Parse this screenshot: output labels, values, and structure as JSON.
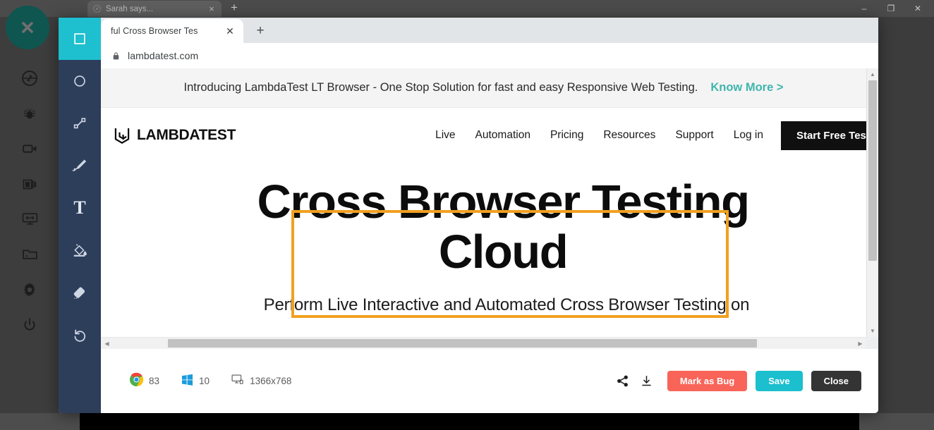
{
  "background_window": {
    "tab": {
      "title": "Sarah says...",
      "close_label": "×",
      "favicon": "leaf-favicon"
    },
    "new_tab_label": "+",
    "window_controls": [
      {
        "name": "minimize",
        "glyph": "–"
      },
      {
        "name": "maximize",
        "glyph": "❐"
      },
      {
        "name": "close",
        "glyph": "✕"
      }
    ],
    "rail_items": [
      {
        "name": "capture-icon",
        "label": "Screenshot"
      },
      {
        "name": "bug-icon",
        "label": "Report Bug"
      },
      {
        "name": "video-camera-icon",
        "label": "Record Video"
      },
      {
        "name": "layers-icon",
        "label": "Full Page Screenshot"
      },
      {
        "name": "responsive-monitor-icon",
        "label": "Responsive Test"
      },
      {
        "name": "folder-icon",
        "label": "Projects"
      },
      {
        "name": "gear-icon",
        "label": "Settings"
      },
      {
        "name": "power-icon",
        "label": "Log out"
      }
    ],
    "close_fab": {
      "name": "close-overlay-button",
      "glyph": "✕"
    }
  },
  "editor": {
    "tools": [
      {
        "name": "rectangle-tool",
        "label": "Rectangle",
        "active": true
      },
      {
        "name": "ellipse-tool",
        "label": "Ellipse",
        "active": false
      },
      {
        "name": "line-tool",
        "label": "Line",
        "active": false
      },
      {
        "name": "pen-tool",
        "label": "Pen",
        "active": false
      },
      {
        "name": "text-tool",
        "label": "Text",
        "active": false,
        "glyph": "T"
      },
      {
        "name": "fill-tool",
        "label": "Fill Color",
        "active": false
      },
      {
        "name": "eraser-tool",
        "label": "Eraser",
        "active": false
      },
      {
        "name": "undo-tool",
        "label": "Undo",
        "active": false
      }
    ],
    "annotation": {
      "name": "orange-rectangle-annotation",
      "color": "#f2a01f"
    },
    "environment": [
      {
        "name": "chrome-version",
        "icon": "chrome-icon",
        "value": "83"
      },
      {
        "name": "os-version",
        "icon": "windows-icon",
        "value": "10"
      },
      {
        "name": "resolution",
        "icon": "monitor-icon",
        "value": "1366x768"
      }
    ],
    "actions": {
      "share_icon": "share-icon",
      "download_icon": "download-icon",
      "mark_as_bug_label": "Mark as Bug",
      "save_label": "Save",
      "close_label": "Close",
      "colors": {
        "mark_as_bug": "#f96459",
        "save": "#1bbfce",
        "close": "#343434",
        "active_tool": "#1ebfce",
        "sidebar": "#2d3e5b"
      }
    }
  },
  "captured_browser": {
    "tab": {
      "title": "ful Cross Browser Tes",
      "close_label": "✕"
    },
    "new_tab_label": "+",
    "address": {
      "value": "lambdatest.com",
      "lock_icon": "lock-icon"
    },
    "scrollbars": {
      "vertical_up": "▲",
      "vertical_down": "▼",
      "horizontal_left": "◀",
      "horizontal_right": "▶"
    }
  },
  "captured_page": {
    "promo": {
      "text": "Introducing LambdaTest LT Browser - One Stop Solution for fast and easy Responsive Web Testing.",
      "link": "Know More >",
      "link_color": "#3fb6ad"
    },
    "brand": {
      "name": "lambdatest-logo",
      "text": "LAMBDATEST"
    },
    "nav": [
      {
        "name": "nav-live",
        "label": "Live"
      },
      {
        "name": "nav-automation",
        "label": "Automation"
      },
      {
        "name": "nav-pricing",
        "label": "Pricing"
      },
      {
        "name": "nav-resources",
        "label": "Resources"
      },
      {
        "name": "nav-support",
        "label": "Support"
      },
      {
        "name": "nav-login",
        "label": "Log in"
      }
    ],
    "cta_label": "Start Free Testing",
    "hero": {
      "heading": "Cross Browser Testing Cloud",
      "subheading": "Perform Live Interactive and Automated Cross Browser Testing on"
    }
  }
}
